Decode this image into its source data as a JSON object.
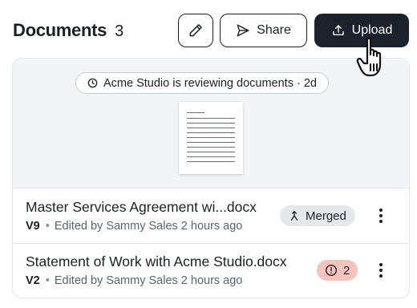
{
  "header": {
    "title": "Documents",
    "count": "3",
    "share_label": "Share",
    "upload_label": "Upload"
  },
  "preview": {
    "status": "Acme Studio is reviewing documents · 2d"
  },
  "documents": [
    {
      "name": "Master Services Agreement wi...docx",
      "version": "V9",
      "edited": "Edited by Sammy Sales 2 hours ago",
      "badge": "Merged"
    },
    {
      "name": "Statement of Work with Acme Studio.docx",
      "version": "V2",
      "edited": "Edited by Sammy Sales 2 hours ago",
      "badge": "2"
    }
  ],
  "icons": {
    "edit": "pencil-icon",
    "share": "send-icon",
    "upload": "upload-icon",
    "status": "clock-icon",
    "merged": "merge-icon",
    "issues": "alert-circle-icon",
    "more": "more-vertical-icon",
    "cursor": "hand-pointer-icon"
  },
  "colors": {
    "upload_bg": "#1b222c",
    "issues_badge_bg": "#f6c3bd",
    "merged_badge_bg": "#e6e7ea",
    "preview_bg": "#f3f4f6"
  }
}
